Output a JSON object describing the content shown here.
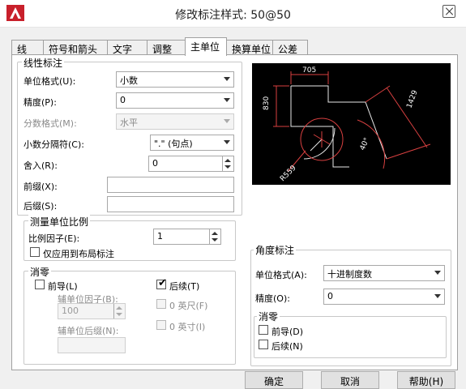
{
  "window": {
    "title": "修改标注样式: 50@50"
  },
  "tabs": [
    "线",
    "符号和箭头",
    "文字",
    "调整",
    "主单位",
    "换算单位",
    "公差"
  ],
  "linear": {
    "title": "线性标注",
    "unit_format_label": "单位格式(U):",
    "unit_format_value": "小数",
    "precision_label": "精度(P):",
    "precision_value": "0",
    "fraction_label": "分数格式(M):",
    "fraction_value": "水平",
    "decimal_sep_label": "小数分隔符(C):",
    "decimal_sep_value": "\".\" (句点)",
    "round_label": "舍入(R):",
    "round_value": "0",
    "prefix_label": "前缀(X):",
    "prefix_value": "",
    "suffix_label": "后缀(S):",
    "suffix_value": ""
  },
  "scale": {
    "title": "测量单位比例",
    "factor_label": "比例因子(E):",
    "factor_value": "1",
    "layout_only_label": "仅应用到布局标注"
  },
  "zero": {
    "title": "消零",
    "leading_label": "前导(L)",
    "trailing_label": "后续(T)",
    "sub_factor_label": "辅单位因子(B):",
    "sub_factor_value": "100",
    "sub_suffix_label": "辅单位后缀(N):",
    "sub_suffix_value": "",
    "feet_label": "0 英尺(F)",
    "inches_label": "0 英寸(I)"
  },
  "angular": {
    "title": "角度标注",
    "unit_format_label": "单位格式(A):",
    "unit_format_value": "十进制度数",
    "precision_label": "精度(O):",
    "precision_value": "0",
    "zero_title": "消零",
    "leading_label": "前导(D)",
    "trailing_label": "后续(N)"
  },
  "preview": {
    "dim_top": "705",
    "dim_left": "830",
    "dim_diag": "1429",
    "dim_angle": "40°",
    "dim_radius": "R559"
  },
  "buttons": {
    "ok": "确定",
    "cancel": "取消",
    "help": "帮助(H)"
  }
}
